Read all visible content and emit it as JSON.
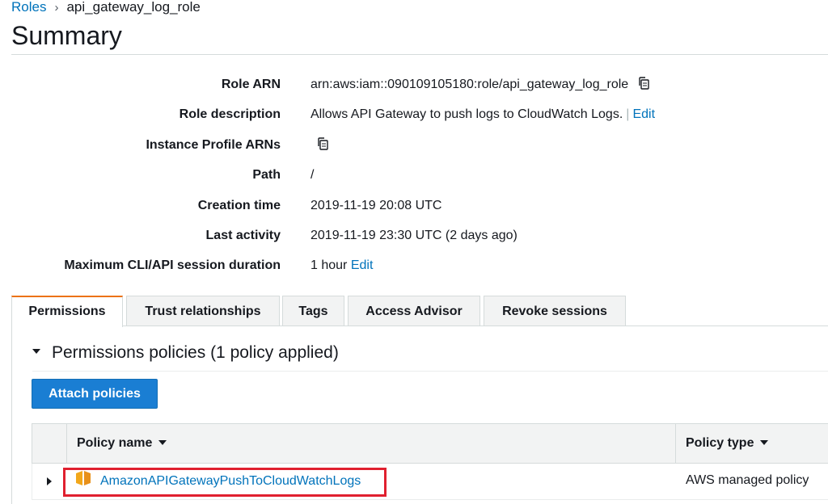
{
  "breadcrumb": {
    "root": "Roles",
    "separator": "›",
    "current": "api_gateway_log_role"
  },
  "page_title": "Summary",
  "summary": [
    {
      "key": "Role ARN",
      "value": "arn:aws:iam::090109105180:role/api_gateway_log_role",
      "copy_icon": "copy-icon"
    },
    {
      "key": "Role description",
      "value": "Allows API Gateway to push logs to CloudWatch Logs.",
      "separator": "|",
      "link": "Edit"
    },
    {
      "key": "Instance Profile ARNs",
      "value": "",
      "copy_icon": "copy-icon"
    },
    {
      "key": "Path",
      "value": "/"
    },
    {
      "key": "Creation time",
      "value": "2019-11-19 20:08 UTC"
    },
    {
      "key": "Last activity",
      "value": "2019-11-19 23:30 UTC (2 days ago)"
    },
    {
      "key": "Maximum CLI/API session duration",
      "value": "1 hour",
      "link": "Edit"
    }
  ],
  "tabs": [
    {
      "label": "Permissions",
      "active": true
    },
    {
      "label": "Trust relationships",
      "active": false
    },
    {
      "label": "Tags",
      "active": false
    },
    {
      "label": "Access Advisor",
      "active": false
    },
    {
      "label": "Revoke sessions",
      "active": false
    }
  ],
  "permissions": {
    "section_title": "Permissions policies (1 policy applied)",
    "attach_button": "Attach policies",
    "table": {
      "columns": [
        "Policy name",
        "Policy type"
      ],
      "rows": [
        {
          "name": "AmazonAPIGatewayPushToCloudWatchLogs",
          "type": "AWS managed policy",
          "icon": "aws-managed-policy-icon",
          "highlighted": true
        }
      ]
    }
  },
  "colors": {
    "link": "#0073bb",
    "primary_button": "#1a7ed3",
    "active_tab_accent": "#ec7211",
    "highlight_border": "#e0202f",
    "policy_icon": "#f2a71b"
  }
}
